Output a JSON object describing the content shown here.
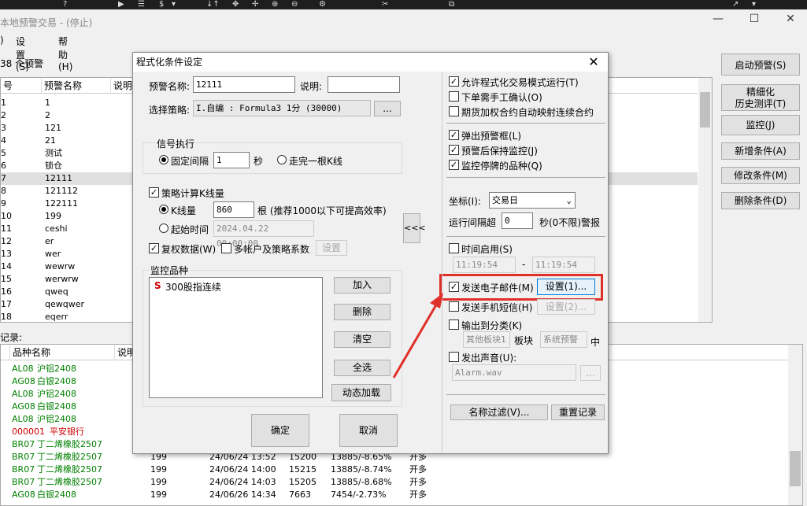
{
  "app": {
    "title": "本地预警交易 - (停止)",
    "menu": [
      "设置(S)",
      "帮助(H)"
    ],
    "minimize": "—",
    "maximize": "☐",
    "close": "✕"
  },
  "toolbar": {
    "icons": [
      "?",
      "▶",
      "☰",
      "$",
      "▾",
      "↓↑",
      "✥",
      "✢",
      "⊕",
      "⊖",
      "⚙",
      "✂",
      "⧉",
      "↗",
      "▾"
    ]
  },
  "alerts": {
    "count_label": "38 个预警",
    "columns": [
      "号",
      "预警名称",
      "说明"
    ],
    "rows": [
      {
        "no": "1",
        "name": "1"
      },
      {
        "no": "2",
        "name": "2"
      },
      {
        "no": "3",
        "name": "121"
      },
      {
        "no": "4",
        "name": "21"
      },
      {
        "no": "5",
        "name": "测试"
      },
      {
        "no": "6",
        "name": "锁仓"
      },
      {
        "no": "7",
        "name": "12111"
      },
      {
        "no": "8",
        "name": "121112"
      },
      {
        "no": "9",
        "name": "122111"
      },
      {
        "no": "10",
        "name": "199"
      },
      {
        "no": "11",
        "name": "ceshi"
      },
      {
        "no": "12",
        "name": "er"
      },
      {
        "no": "13",
        "name": "wer"
      },
      {
        "no": "14",
        "name": "wewrw"
      },
      {
        "no": "15",
        "name": "werwrw"
      },
      {
        "no": "16",
        "name": "qweq"
      },
      {
        "no": "17",
        "name": "qewqwer"
      },
      {
        "no": "18",
        "name": "eqerr"
      }
    ]
  },
  "right_buttons": [
    "启动预警(S)",
    "精细化\n历史测评(T)",
    "监控(J)",
    "新增条件(A)",
    "修改条件(M)",
    "删除条件(D)"
  ],
  "records": {
    "label": "记录:",
    "columns": [
      "品种名称",
      "说明"
    ],
    "rows": [
      {
        "code": "AL08",
        "name": "沪铝2408",
        "color": "#008000"
      },
      {
        "code": "AG08",
        "name": "白银2408",
        "color": "#008000"
      },
      {
        "code": "AL08",
        "name": "沪铝2408",
        "color": "#008000"
      },
      {
        "code": "AG08",
        "name": "白银2408",
        "color": "#008000"
      },
      {
        "code": "AL08",
        "name": "沪铝2408",
        "color": "#008000"
      },
      {
        "code": "000001",
        "name": "平安银行",
        "color": "#cc0000"
      },
      {
        "code": "BR07",
        "name": "丁二烯橡胶2507",
        "color": "#008000"
      },
      {
        "code": "BR07",
        "name": "丁二烯橡胶2507",
        "color": "#008000",
        "v1": "199",
        "time": "24/06/24 13:52",
        "price": "15200",
        "chg": "13885/-8.65%",
        "act": "开多"
      },
      {
        "code": "BR07",
        "name": "丁二烯橡胶2507",
        "color": "#008000",
        "v1": "199",
        "time": "24/06/24 14:00",
        "price": "15215",
        "chg": "13885/-8.74%",
        "act": "开多"
      },
      {
        "code": "BR07",
        "name": "丁二烯橡胶2507",
        "color": "#008000",
        "v1": "199",
        "time": "24/06/24 14:03",
        "price": "15205",
        "chg": "13885/-8.68%",
        "act": "开多"
      },
      {
        "code": "AG08",
        "name": "白银2408",
        "color": "#008000",
        "v1": "199",
        "time": "24/06/26 14:34",
        "price": "7663",
        "chg": "7454/-2.73%",
        "act": "开多"
      }
    ]
  },
  "dialog": {
    "title": "程式化条件设定",
    "close": "✕",
    "alert_name_label": "预警名称:",
    "alert_name": "12111",
    "desc_label": "说明:",
    "desc": "",
    "strategy_label": "选择策略:",
    "strategy": "I.自编 : Formula3 1分 (30000)",
    "strategy_btn": "...",
    "signal_group": "信号执行",
    "fixed_interval": "固定间隔",
    "interval_value": "1",
    "sec": "秒",
    "kline_end": "走完一根K线",
    "calc_kline": "策略计算K线量",
    "kline_qty_label": "K线量",
    "kline_qty": "860",
    "kline_hint": "根 (推荐1000以下可提高效率)",
    "start_time_label": "起始时间",
    "start_time": "2024.04.22 00:00:00",
    "rights_data": "复权数据(W)",
    "multi_acct": "多帐户及策略系数",
    "setup": "设置",
    "monitor_group": "监控品种",
    "monitor_item_prefix": "S",
    "monitor_item": "300股指连续",
    "add": "加入",
    "delete": "删除",
    "clear": "清空",
    "select_all": "全选",
    "dynamic_load": "动态加载",
    "ok": "确定",
    "cancel": "取消",
    "collapse": "<<<",
    "allow_prog": "允许程式化交易模式运行(T)",
    "manual_confirm": "下单需手工确认(O)",
    "futures_map": "期货加权合约自动映射连续合约",
    "popup": "弹出预警框(L)",
    "keep_monitor": "预警后保持监控(J)",
    "monitor_suspended": "监控停牌的品种(Q)",
    "coord_label": "坐标(I):",
    "coord_value": "交易日",
    "run_interval_label": "运行间隔超",
    "run_interval": "0",
    "run_interval_hint": "秒(0不限)警报",
    "time_enable": "时间启用(S)",
    "time_from": "11:19:54",
    "time_to": "11:19:54",
    "dash": "-",
    "send_email": "发送电子邮件(M)",
    "email_setup": "设置(1)...",
    "send_sms": "发送手机短信(H)",
    "sms_setup": "设置(2)...",
    "output_cat": "输出到分类(K)",
    "cat_other": "其他板块1",
    "board": "板块",
    "sys_alert": "系统预警",
    "zhong": "中",
    "sound": "发出声音(U):",
    "sound_file": "Alarm.wav",
    "sound_btn": "...",
    "name_filter": "名称过滤(V)...",
    "reset_records": "重置记录"
  },
  "colors": {
    "highlight": "#e0302a",
    "green": "#008000",
    "red": "#cc0000"
  }
}
